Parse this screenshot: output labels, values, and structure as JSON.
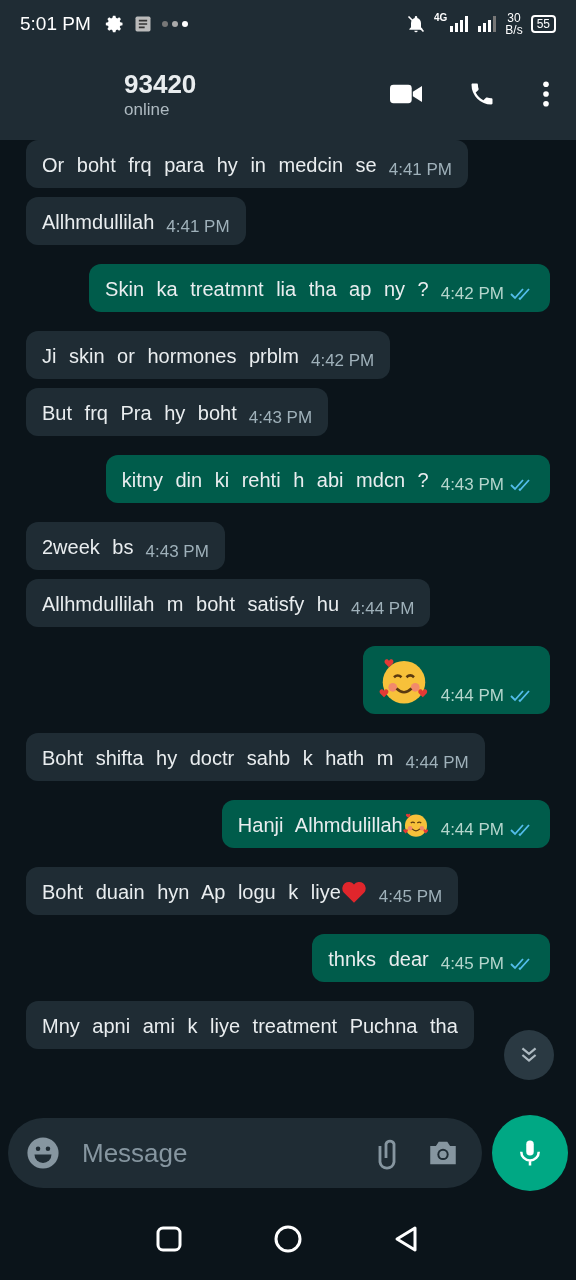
{
  "status_bar": {
    "time": "5:01 PM",
    "speed": "30",
    "speed_unit": "B/s",
    "battery": "55",
    "network": "4G"
  },
  "header": {
    "name": "93420",
    "presence": "online"
  },
  "messages": [
    {
      "kind": "incoming",
      "text": "Or boht frq para hy in medcin se",
      "time": "4:41 PM"
    },
    {
      "kind": "incoming",
      "text": "Allhmdullilah",
      "time": "4:41 PM"
    },
    {
      "kind": "outgoing",
      "text": "Skin ka treatmnt lia tha ap ny ?",
      "time": "4:42 PM",
      "read": true
    },
    {
      "kind": "incoming",
      "text": "Ji skin or hormones prblm",
      "time": "4:42 PM"
    },
    {
      "kind": "incoming",
      "text": "But frq Pra hy boht",
      "time": "4:43 PM"
    },
    {
      "kind": "outgoing",
      "text": "kitny din ki rehti h abi mdcn ?",
      "time": "4:43 PM",
      "read": true
    },
    {
      "kind": "incoming",
      "text": "2week bs",
      "time": "4:43 PM"
    },
    {
      "kind": "incoming",
      "text": "Allhmdullilah m boht satisfy hu",
      "time": "4:44 PM"
    },
    {
      "kind": "outgoing",
      "sticker": {
        "kind": "smile-hearts"
      },
      "time": "4:44 PM",
      "read": true
    },
    {
      "kind": "incoming",
      "text": "Boht shifta hy doctr sahb k hath m",
      "time": "4:44 PM"
    },
    {
      "kind": "outgoing",
      "text": "Hanji Alhmdulillah",
      "sticker": {
        "kind": "smile-hearts"
      },
      "time": "4:44 PM",
      "read": true
    },
    {
      "kind": "incoming",
      "text": "Boht duain hyn Ap logu k liye",
      "sticker": {
        "kind": "heart"
      },
      "time": "4:45 PM"
    },
    {
      "kind": "outgoing",
      "text": "thnks dear",
      "time": "4:45 PM",
      "read": true
    },
    {
      "kind": "incoming",
      "text": "Mny apni ami k liye treatment Puchna tha"
    }
  ],
  "composer": {
    "placeholder": "Message"
  }
}
